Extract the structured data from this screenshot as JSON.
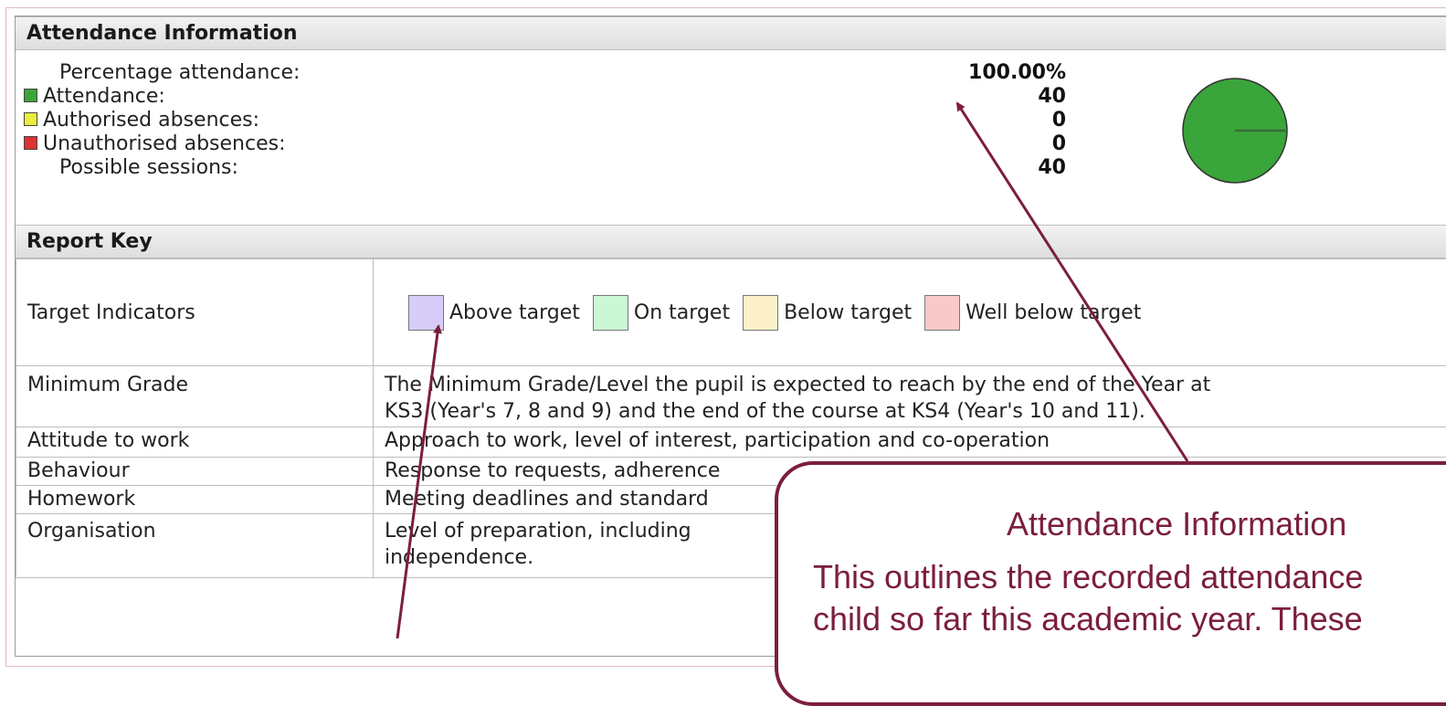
{
  "attendance": {
    "header": "Attendance Information",
    "rows": [
      {
        "label": "Percentage attendance:",
        "value": "100.00%",
        "color": null
      },
      {
        "label": "Attendance:",
        "value": "40",
        "color": "#3aa53a"
      },
      {
        "label": "Authorised absences:",
        "value": "0",
        "color": "#ecec3c"
      },
      {
        "label": "Unauthorised absences:",
        "value": "0",
        "color": "#dd3333"
      },
      {
        "label": "Possible sessions:",
        "value": "40",
        "color": null
      }
    ],
    "pie_color": "#3aa53a"
  },
  "report_key": {
    "header": "Report Key",
    "target_indicators": {
      "label": "Target Indicators",
      "items": [
        {
          "label": "Above target",
          "color": "#d8ccf8"
        },
        {
          "label": "On target",
          "color": "#ccf7d5"
        },
        {
          "label": "Below target",
          "color": "#fcf0c8"
        },
        {
          "label": "Well below target",
          "color": "#f9c9c9"
        }
      ]
    },
    "rows": [
      {
        "label": "Minimum Grade",
        "line1": "The Minimum Grade/Level the pupil is expected to reach by the end of the Year at",
        "line2": "KS3 (Year's 7, 8 and 9) and the end of the course at KS4 (Year's 10 and 11)."
      },
      {
        "label": "Attitude to work",
        "line1": "Approach to work, level of interest, participation and co-operation",
        "line2": ""
      },
      {
        "label": "Behaviour",
        "line1": "Response to requests, adherence",
        "line2": ""
      },
      {
        "label": "Homework",
        "line1": "Meeting deadlines and standard",
        "line2": ""
      },
      {
        "label": "Organisation",
        "line1": "Level of preparation, including",
        "line2": "independence."
      }
    ]
  },
  "callout": {
    "title": "Attendance Information",
    "body_line1": "This outlines the recorded attendance",
    "body_line2": "child so far this academic year. These"
  },
  "annotation_color": "#7b1e3e"
}
